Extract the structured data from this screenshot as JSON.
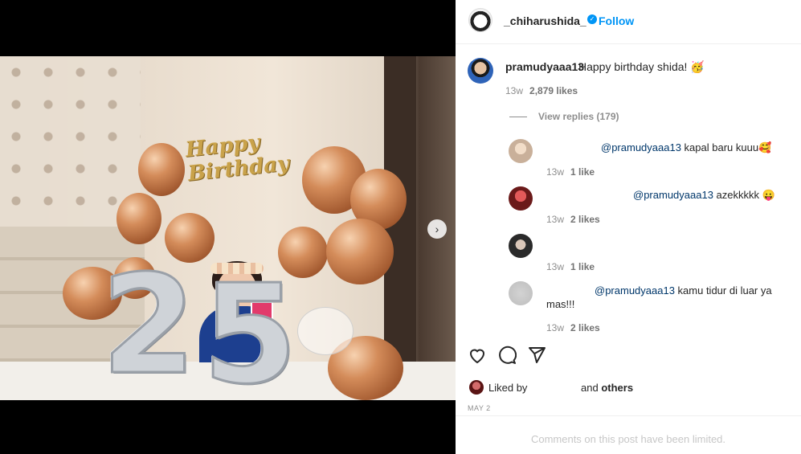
{
  "post": {
    "owner_username": "_chiharushida_",
    "follow_label": "Follow",
    "owner_avatar_icon": "avatar-icon",
    "verified_icon": "verified-badge-icon"
  },
  "photo": {
    "banner_text": "Happy Birthday",
    "number_digits": [
      "2",
      "5"
    ],
    "next_icon": "chevron-right-icon"
  },
  "main_comment": {
    "username": "pramudyaaa13",
    "text": "Happy birthday shida! 🥳",
    "time": "13w",
    "likes": "2,879 likes",
    "view_replies": "View replies (179)"
  },
  "replies": [
    {
      "mention": "@pramudyaaa13",
      "text": " kapal baru kuuu🥰",
      "time": "13w",
      "likes": "1 like"
    },
    {
      "mention": "@pramudyaaa13",
      "text": " azekkkkk 😛",
      "time": "13w",
      "likes": "2 likes"
    },
    {
      "mention": "",
      "text": "",
      "time": "13w",
      "likes": "1 like"
    },
    {
      "mention": "@pramudyaaa13",
      "text": " kamu tidur di luar ya mas!!!",
      "time": "13w",
      "likes": "2 likes"
    }
  ],
  "actions": {
    "like_icon": "heart-icon",
    "comment_icon": "comment-icon",
    "share_icon": "share-icon"
  },
  "liked_by": {
    "prefix": "Liked by",
    "and_text": "and ",
    "others": "others"
  },
  "date": "MAY 2",
  "comments_limited": "Comments on this post have been limited.",
  "colors": {
    "accent": "#0095f6",
    "mention": "#00376b",
    "muted": "#8e8e8e"
  }
}
